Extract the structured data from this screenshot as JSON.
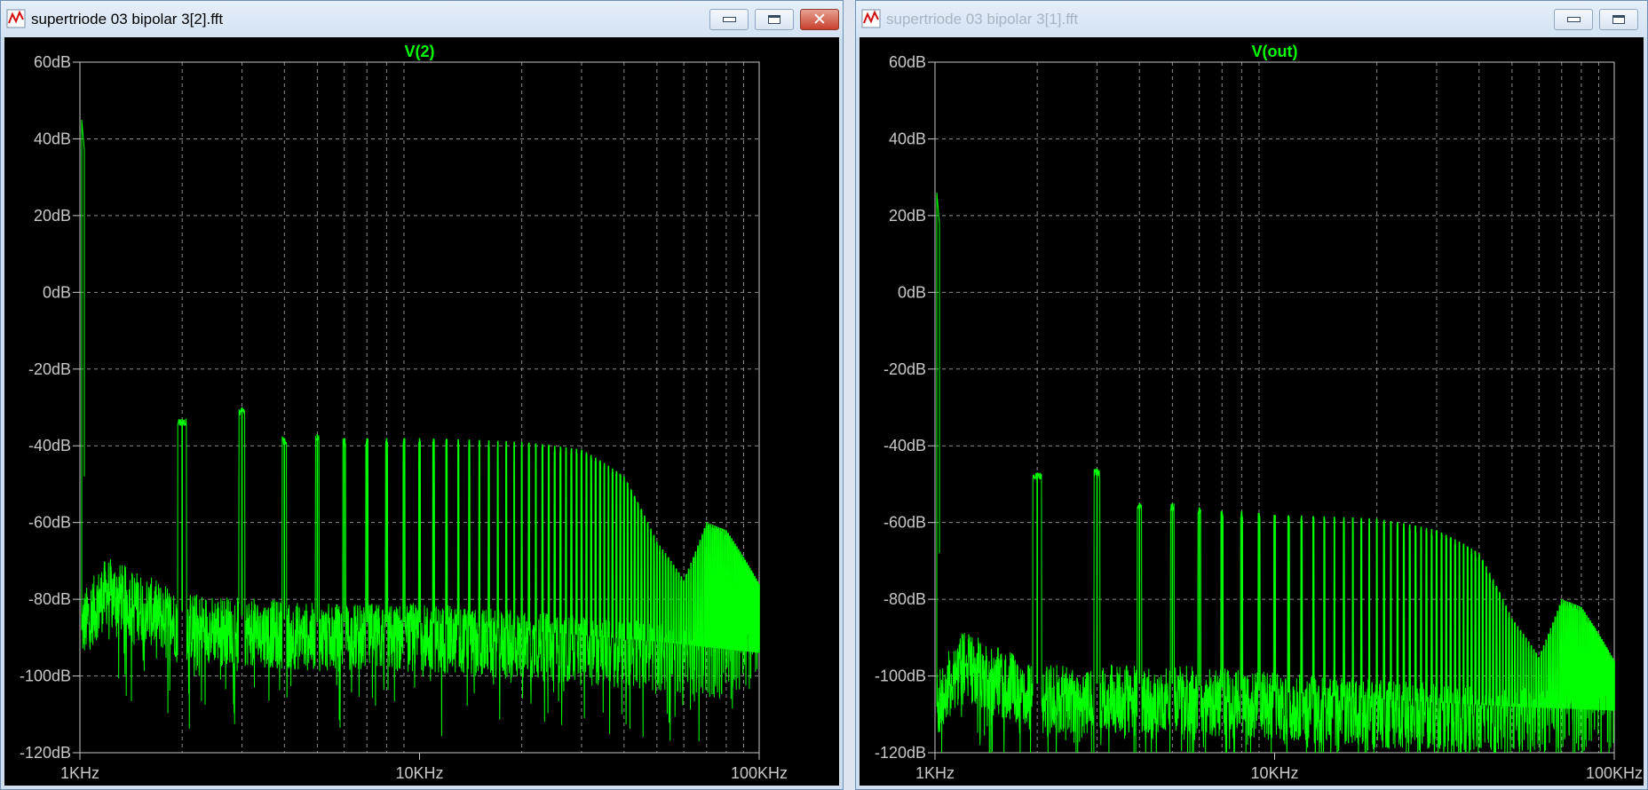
{
  "windows": [
    {
      "title": "supertriode 03 bipolar 3[2].fft",
      "active": true,
      "trace_label": "V(2)"
    },
    {
      "title": "supertriode 03 bipolar 3[1].fft",
      "active": false,
      "trace_label": "V(out)"
    }
  ],
  "colors": {
    "background": "#000000",
    "trace": "#00ff00",
    "grid": "#8c8c8c",
    "axis_text": "#c8c8c8"
  },
  "icons": [
    "waveform-app-icon",
    "minimize-icon",
    "maximize-icon",
    "close-icon"
  ],
  "chart_data": [
    {
      "type": "line",
      "title": "V(2)",
      "xscale": "log",
      "xlim": [
        1000,
        100000
      ],
      "ylim": [
        -120,
        60
      ],
      "xticks": [
        "1KHz",
        "10KHz",
        "100KHz"
      ],
      "yticks": [
        "60dB",
        "40dB",
        "20dB",
        "0dB",
        "-20dB",
        "-40dB",
        "-60dB",
        "-80dB",
        "-100dB",
        "-120dB"
      ],
      "grid": true,
      "series": [
        {
          "fundamental": {
            "x": 1000,
            "y": 45
          },
          "harmonic_peaks": [
            {
              "x": 2000,
              "y": -33
            },
            {
              "x": 3000,
              "y": -30
            },
            {
              "x": 4000,
              "y": -38
            },
            {
              "x": 5000,
              "y": -37
            },
            {
              "x": 6000,
              "y": -38
            },
            {
              "x": 7000,
              "y": -38
            },
            {
              "x": 8000,
              "y": -38
            },
            {
              "x": 10000,
              "y": -38
            },
            {
              "x": 20000,
              "y": -39
            },
            {
              "x": 30000,
              "y": -41
            },
            {
              "x": 40000,
              "y": -48
            },
            {
              "x": 50000,
              "y": -65
            },
            {
              "x": 60000,
              "y": -75
            },
            {
              "x": 70000,
              "y": -60
            },
            {
              "x": 80000,
              "y": -62
            },
            {
              "x": 100000,
              "y": -76
            }
          ],
          "noise_floor": [
            {
              "x": 1000,
              "y": -88
            },
            {
              "x": 1200,
              "y": -78
            },
            {
              "x": 2000,
              "y": -87
            },
            {
              "x": 5000,
              "y": -90
            },
            {
              "x": 10000,
              "y": -90
            },
            {
              "x": 20000,
              "y": -92
            },
            {
              "x": 50000,
              "y": -95
            },
            {
              "x": 100000,
              "y": -98
            }
          ]
        }
      ]
    },
    {
      "type": "line",
      "title": "V(out)",
      "xscale": "log",
      "xlim": [
        1000,
        100000
      ],
      "ylim": [
        -120,
        60
      ],
      "xticks": [
        "1KHz",
        "10KHz",
        "100KHz"
      ],
      "yticks": [
        "60dB",
        "40dB",
        "20dB",
        "0dB",
        "-20dB",
        "-40dB",
        "-60dB",
        "-80dB",
        "-100dB",
        "-120dB"
      ],
      "grid": true,
      "series": [
        {
          "fundamental": {
            "x": 1000,
            "y": 26
          },
          "harmonic_peaks": [
            {
              "x": 2000,
              "y": -47
            },
            {
              "x": 3000,
              "y": -46
            },
            {
              "x": 4000,
              "y": -55
            },
            {
              "x": 5000,
              "y": -55
            },
            {
              "x": 6000,
              "y": -56
            },
            {
              "x": 7000,
              "y": -57
            },
            {
              "x": 8000,
              "y": -57
            },
            {
              "x": 10000,
              "y": -58
            },
            {
              "x": 20000,
              "y": -59
            },
            {
              "x": 30000,
              "y": -62
            },
            {
              "x": 40000,
              "y": -68
            },
            {
              "x": 50000,
              "y": -85
            },
            {
              "x": 60000,
              "y": -95
            },
            {
              "x": 70000,
              "y": -80
            },
            {
              "x": 80000,
              "y": -82
            },
            {
              "x": 100000,
              "y": -96
            }
          ],
          "noise_floor": [
            {
              "x": 1000,
              "y": -108
            },
            {
              "x": 1200,
              "y": -97
            },
            {
              "x": 2000,
              "y": -106
            },
            {
              "x": 5000,
              "y": -106
            },
            {
              "x": 10000,
              "y": -108
            },
            {
              "x": 20000,
              "y": -110
            },
            {
              "x": 50000,
              "y": -112
            },
            {
              "x": 100000,
              "y": -113
            }
          ]
        }
      ]
    }
  ]
}
